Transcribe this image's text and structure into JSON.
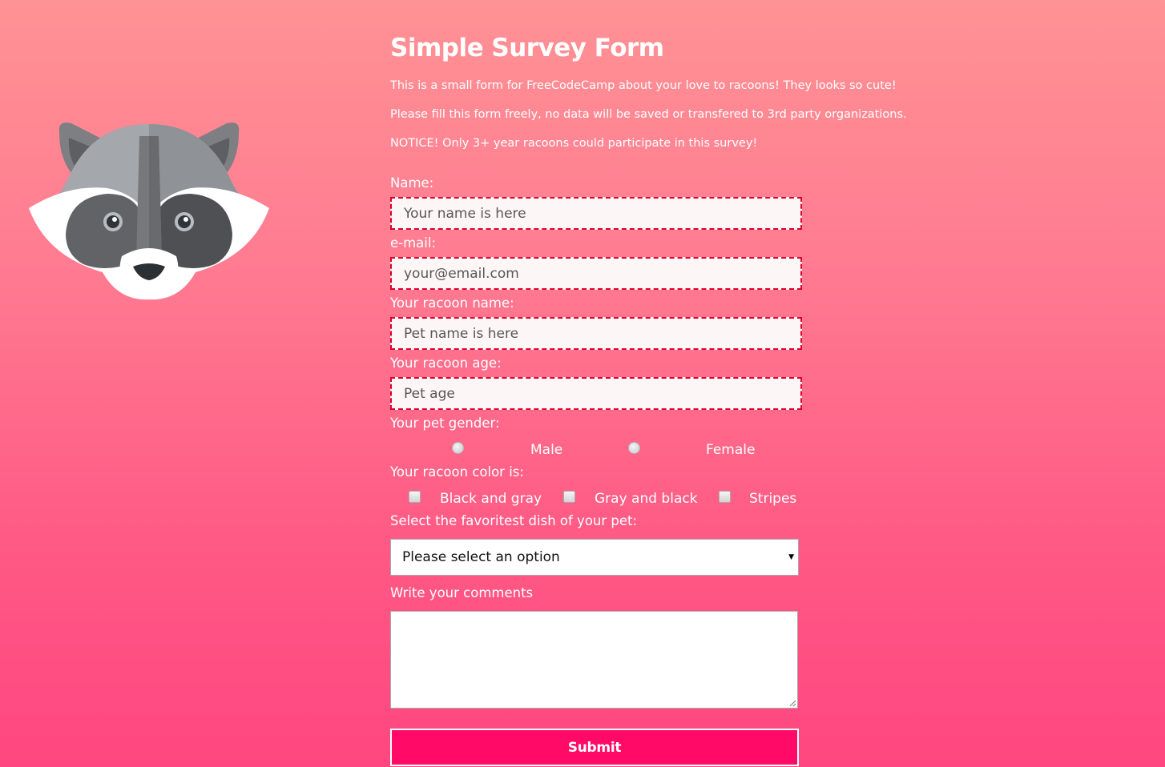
{
  "page": {
    "title": "Simple Survey Form",
    "description": [
      "This is a small form for FreeCodeCamp about your love to racoons! They looks so cute!",
      "Please fill this form freely, no data will be saved or transfered to 3rd party organizations.",
      "NOTICE! Only 3+ year racoons could participate in this survey!"
    ]
  },
  "form": {
    "name": {
      "label": "Name:",
      "placeholder": "Your name is here"
    },
    "email": {
      "label": "e-mail:",
      "placeholder": "your@email.com"
    },
    "pet_name": {
      "label": "Your racoon name:",
      "placeholder": "Pet name is here"
    },
    "pet_age": {
      "label": "Your racoon age:",
      "placeholder": "Pet age"
    },
    "gender": {
      "label": "Your pet gender:",
      "options": [
        "Male",
        "Female"
      ]
    },
    "color": {
      "label": "Your racoon color is:",
      "options": [
        "Black and gray",
        "Gray and black",
        "Stripes"
      ]
    },
    "dish": {
      "label": "Select the favoritest dish of your pet:",
      "selected": "Please select an option"
    },
    "comments": {
      "label": "Write your comments"
    },
    "submit_label": "Submit"
  },
  "colors": {
    "background_top": "#ff9294",
    "background_bottom": "#ff4680",
    "field_border": "#e0002a",
    "submit_background": "#ff0b67"
  },
  "icons": {
    "logo": "raccoon-face-icon",
    "select_arrow": "dropdown-arrow-icon"
  }
}
